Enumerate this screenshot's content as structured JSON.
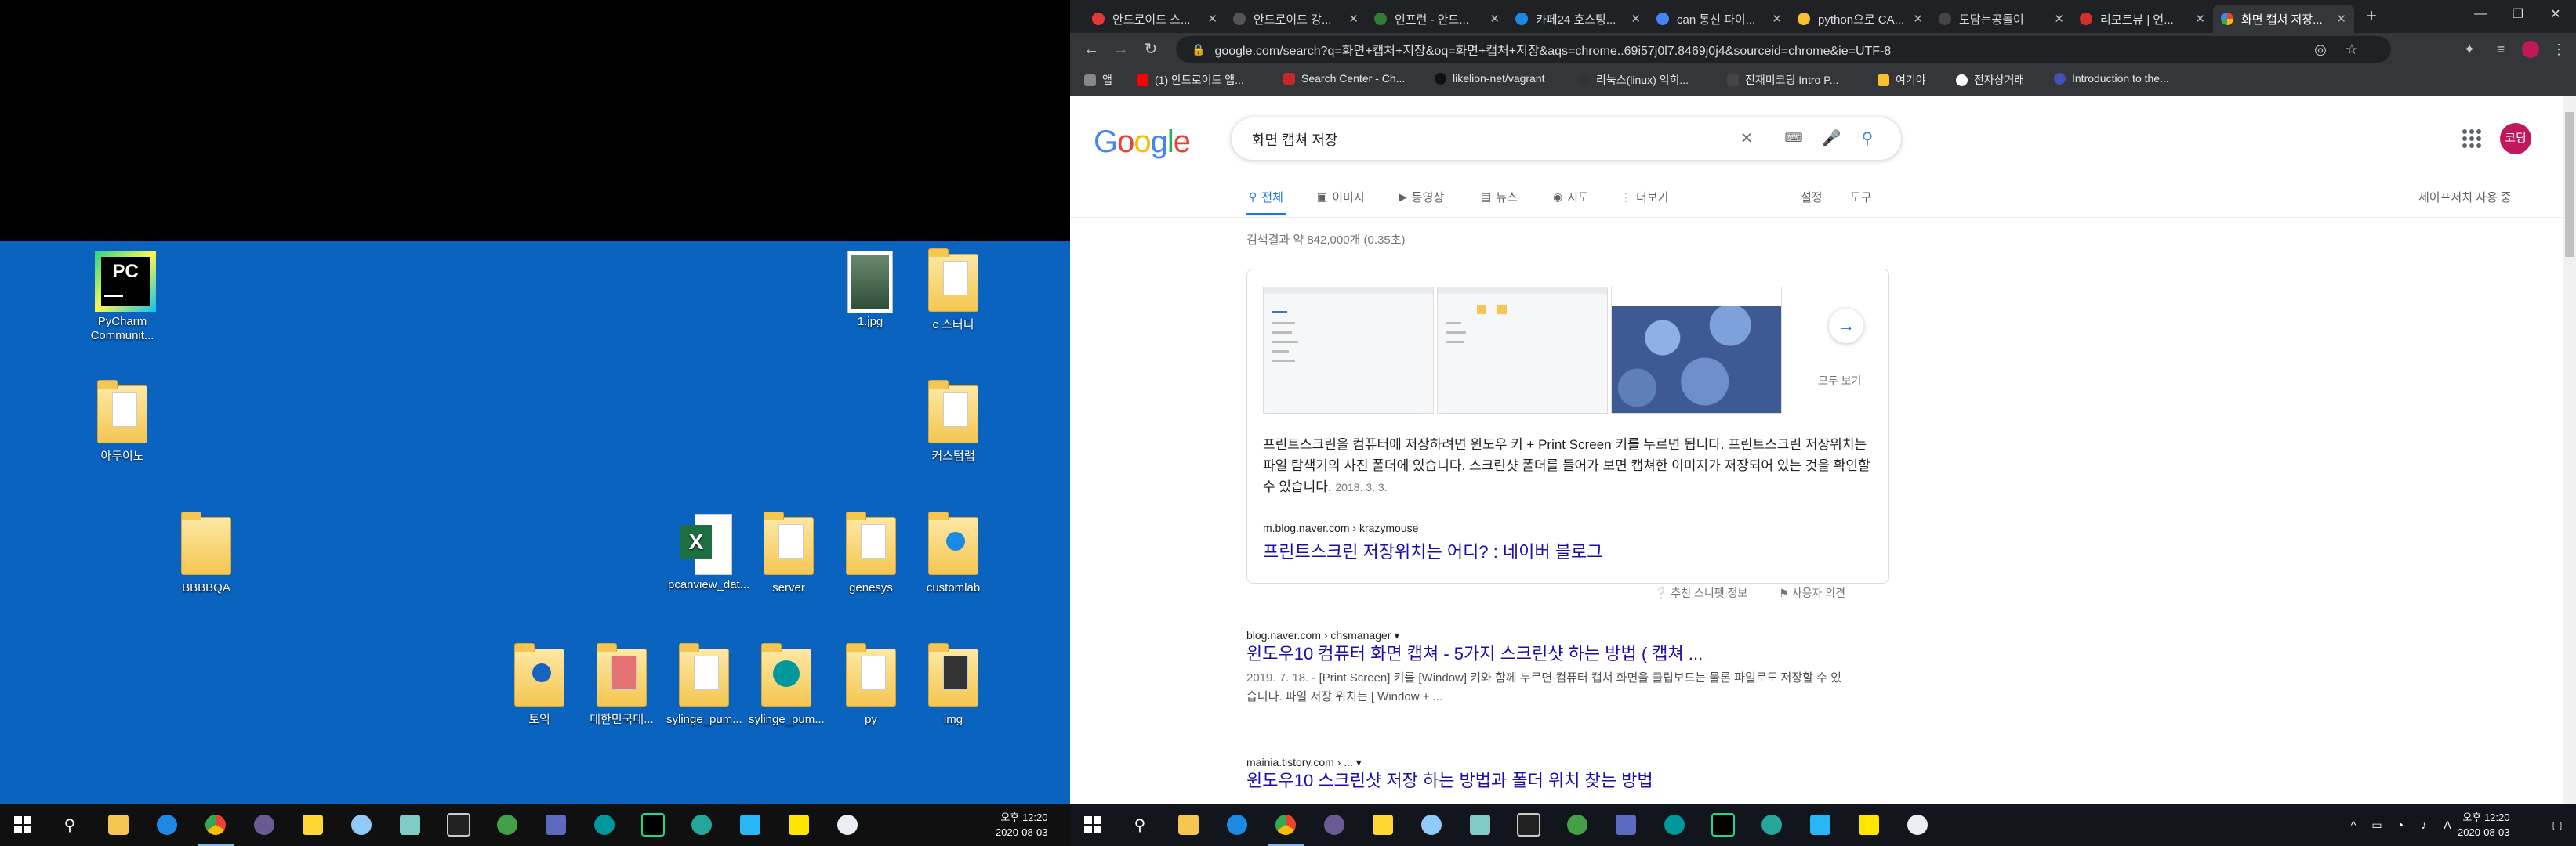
{
  "left_desktop": {
    "icons": [
      {
        "label": "PyCharm Communit...",
        "kind": "pycharm"
      },
      {
        "label": "아두이노",
        "kind": "folder"
      },
      {
        "label": "BBBBQA",
        "kind": "folder"
      },
      {
        "label": "1.jpg",
        "kind": "image"
      },
      {
        "label": "c 스터디",
        "kind": "folder"
      },
      {
        "label": "커스텀랩",
        "kind": "folder"
      },
      {
        "label": "pcanview_dat...",
        "kind": "excel"
      },
      {
        "label": "server",
        "kind": "folder"
      },
      {
        "label": "genesys",
        "kind": "folder"
      },
      {
        "label": "customlab",
        "kind": "folder-edge"
      },
      {
        "label": "토익",
        "kind": "folder"
      },
      {
        "label": "대한민국대...",
        "kind": "folder"
      },
      {
        "label": "sylinge_pum...",
        "kind": "folder"
      },
      {
        "label": "sylinge_pum...",
        "kind": "arduino"
      },
      {
        "label": "py",
        "kind": "folder"
      },
      {
        "label": "img",
        "kind": "folder-dark"
      }
    ]
  },
  "taskbar_left": {
    "time": "오후 12:20",
    "date": "2020-08-03"
  },
  "taskbar_right": {
    "time": "오후 12:20",
    "date": "2020-08-03"
  },
  "browser": {
    "tabs": [
      {
        "label": "안드로이드 스...",
        "color": "#e53935"
      },
      {
        "label": "안드로이드 강...",
        "color": "#333333"
      },
      {
        "label": "인프런 - 안드...",
        "color": "#2e7d32"
      },
      {
        "label": "카페24 호스팅...",
        "color": "#1e88e5"
      },
      {
        "label": "can 통신 파이...",
        "color": "#4285f4"
      },
      {
        "label": "python으로 CA...",
        "color": "#fbc02d"
      },
      {
        "label": "도담는공돌이",
        "color": "#222222"
      },
      {
        "label": "리모트뷰 | 언...",
        "color": "#d32f2f"
      },
      {
        "label": "화면 캡쳐 저장...",
        "color": "#4285f4"
      }
    ],
    "url": "google.com/search?q=화면+캡처+저장&oq=화면+캡처+저장&aqs=chrome..69i57j0l7.8469j0j4&sourceid=chrome&ie=UTF-8",
    "bookmarks": [
      {
        "label": "앱",
        "color": "#888888"
      },
      {
        "label": "(1) 안드로이드 앱...",
        "color": "#ff0000"
      },
      {
        "label": "Search Center - Ch...",
        "color": "#c62828"
      },
      {
        "label": "likelion-net/vagrant",
        "color": "#111111"
      },
      {
        "label": "리눅스(linux) 익히...",
        "color": "#333333"
      },
      {
        "label": "진재미코딩 Intro P...",
        "color": "#444444"
      },
      {
        "label": "여기야",
        "color": "#fbc02d"
      },
      {
        "label": "전자상거래",
        "color": "#ffffff"
      },
      {
        "label": "Introduction to the...",
        "color": "#3f51b5"
      }
    ]
  },
  "google": {
    "logo": "Google",
    "query": "화면 캡쳐 저장",
    "avatar_text": "코딩",
    "tabs": [
      {
        "label": "전체",
        "icon": "search"
      },
      {
        "label": "이미지",
        "icon": "image"
      },
      {
        "label": "동영상",
        "icon": "video"
      },
      {
        "label": "뉴스",
        "icon": "news"
      },
      {
        "label": "지도",
        "icon": "pin"
      },
      {
        "label": "더보기",
        "icon": "more"
      }
    ],
    "settings": "설정",
    "tools": "도구",
    "safesearch": "세이프서치 사용 중",
    "result_stats": "검색결과 약 842,000개 (0.35초)",
    "featured": {
      "more_label": "모두 보기",
      "text": "프린트스크린을 컴퓨터에 저장하려면 윈도우 키 + Print Screen 키를 누르면 됩니다. 프린트스크린 저장위치는 파일 탐색기의 사진 폴더에 있습니다. 스크린샷 폴더를 들어가 보면 캡쳐한 이미지가 저장되어 있는 것을 확인할 수 있습니다.",
      "date": "2018. 3. 3.",
      "cite": "m.blog.naver.com › krazymouse",
      "title": "프린트스크린 저장위치는 어디? : 네이버 블로그",
      "feedback_about": "추천 스니펫 정보",
      "feedback_send": "사용자 의견"
    },
    "results": [
      {
        "cite": "blog.naver.com › chsmanager",
        "title": "윈도우10 컴퓨터 화면 캡쳐 - 5가지 스크린샷 하는 방법 ( 캡쳐 ...",
        "date": "2019. 7. 18.",
        "desc": "- [Print Screen] 키를 [Window] 키와 함께 누르면 컴퓨터 캡쳐 화면을 클립보드는 물론 파일로도 저장할 수 있습니다. 파일 저장 위치는 [ Window + ..."
      },
      {
        "cite": "mainia.tistory.com › ...",
        "title": "윈도우10 스크린샷 저장 하는 방법과 폴더 위치 찾는 방법",
        "date": "",
        "desc": ""
      }
    ]
  }
}
